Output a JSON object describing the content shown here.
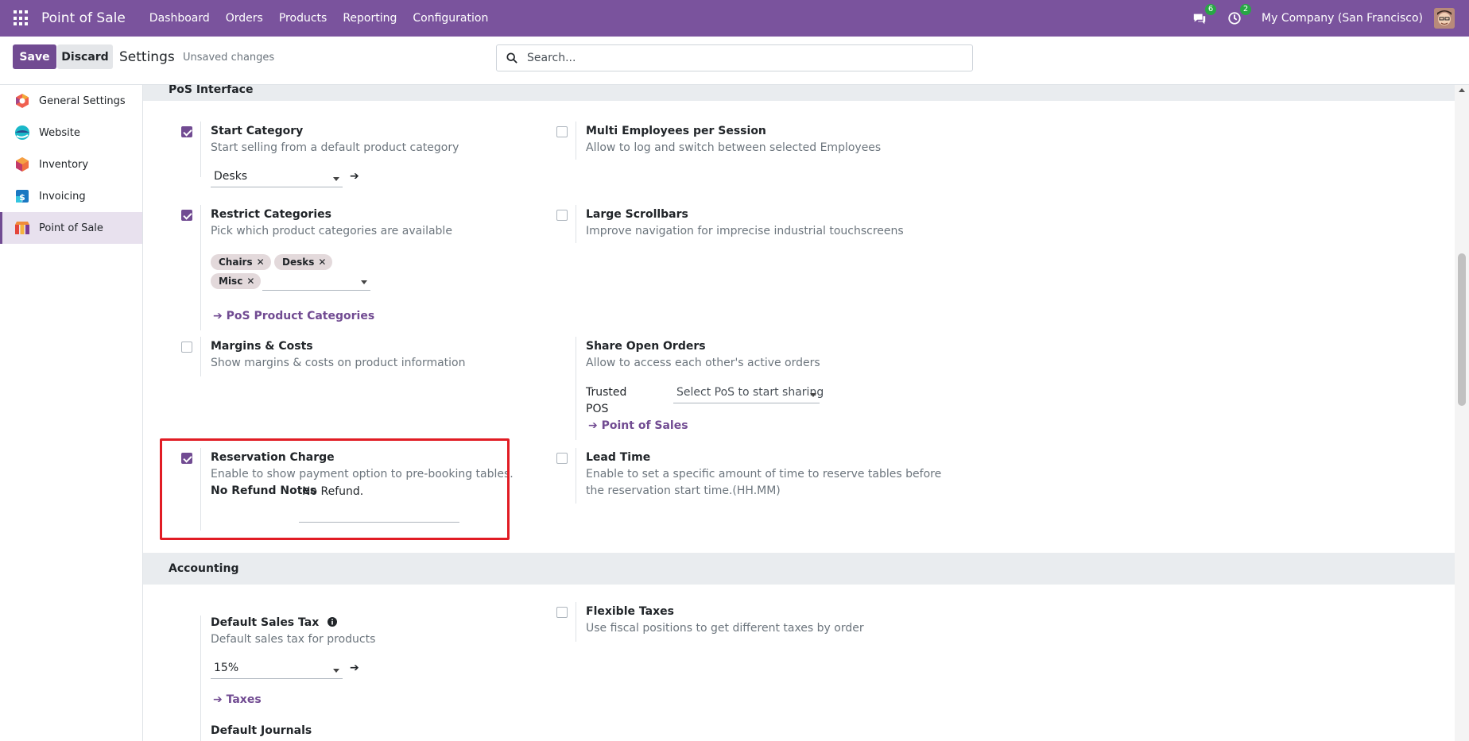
{
  "navbar": {
    "app_name": "Point of Sale",
    "menu": [
      "Dashboard",
      "Orders",
      "Products",
      "Reporting",
      "Configuration"
    ],
    "messages_count": "6",
    "activities_count": "2",
    "company": "My Company (San Francisco)"
  },
  "control_panel": {
    "save_label": "Save",
    "discard_label": "Discard",
    "title": "Settings",
    "status": "Unsaved changes",
    "search_placeholder": "Search..."
  },
  "sidebar": {
    "items": [
      {
        "label": "General Settings",
        "icon": "general-settings-icon"
      },
      {
        "label": "Website",
        "icon": "website-icon"
      },
      {
        "label": "Inventory",
        "icon": "inventory-icon"
      },
      {
        "label": "Invoicing",
        "icon": "invoicing-icon"
      },
      {
        "label": "Point of Sale",
        "icon": "point-of-sale-icon",
        "active": true
      }
    ]
  },
  "pos_interface": {
    "heading": "PoS Interface",
    "start_category": {
      "title": "Start Category",
      "desc": "Start selling from a default product category",
      "value": "Desks",
      "checked": true
    },
    "multi_employees": {
      "title": "Multi Employees per Session",
      "desc": "Allow to log and switch between selected Employees",
      "checked": false
    },
    "restrict_categories": {
      "title": "Restrict Categories",
      "desc": "Pick which product categories are available",
      "tags": [
        "Chairs",
        "Desks",
        "Misc"
      ],
      "link": "PoS Product Categories",
      "checked": true
    },
    "large_scrollbars": {
      "title": "Large Scrollbars",
      "desc": "Improve navigation for imprecise industrial touchscreens",
      "checked": false
    },
    "margins_costs": {
      "title": "Margins & Costs",
      "desc": "Show margins & costs on product information",
      "checked": false
    },
    "share_open_orders": {
      "title": "Share Open Orders",
      "desc": "Allow to access each other's active orders",
      "trusted_label_1": "Trusted",
      "trusted_label_2": "POS",
      "trusted_placeholder": "Select PoS to start sharing",
      "link": "Point of Sales"
    },
    "reservation_charge": {
      "title": "Reservation Charge",
      "desc": "Enable to show payment option to pre-booking tables.",
      "notes_label": "No Refund Notes",
      "notes_value": "No Refund.",
      "checked": true
    },
    "lead_time": {
      "title": "Lead Time",
      "desc_1": "Enable to set a specific amount of time to reserve tables before",
      "desc_2": "the reservation start time.(HH.MM)",
      "checked": false
    }
  },
  "accounting": {
    "heading": "Accounting",
    "default_sales_tax": {
      "title": "Default Sales Tax",
      "desc": "Default sales tax for products",
      "value": "15%",
      "link": "Taxes"
    },
    "flexible_taxes": {
      "title": "Flexible Taxes",
      "desc": "Use fiscal positions to get different taxes by order",
      "checked": false
    },
    "default_journals": {
      "title": "Default Journals"
    }
  }
}
